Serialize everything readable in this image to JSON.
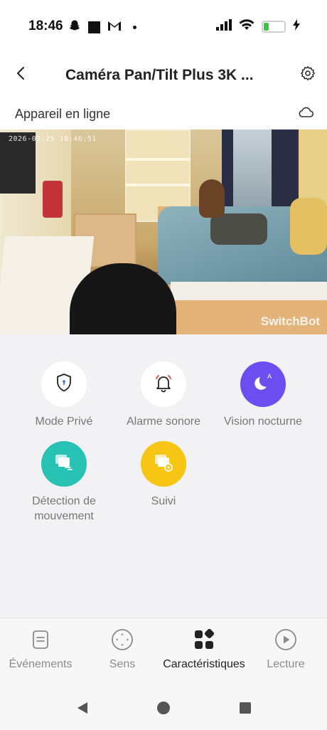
{
  "status_bar": {
    "time": "18:46",
    "left_icons": [
      "snapchat-icon",
      "square-notification-icon",
      "gmail-icon",
      "dot-icon"
    ],
    "right_icons": [
      "signal-icon",
      "wifi-icon",
      "battery-charging-icon"
    ],
    "battery_level": 0.25,
    "battery_color": "#3fc24a"
  },
  "header": {
    "title": "Caméra Pan/Tilt Plus 3K ...",
    "back_icon": "chevron-left-icon",
    "settings_icon": "gear-icon"
  },
  "device": {
    "status": "Appareil en ligne",
    "cloud_icon": "cloud-icon"
  },
  "video": {
    "timestamp": "2026-02-25 18:46:51",
    "watermark": "SwitchBot"
  },
  "features": [
    {
      "label": "Mode Privé",
      "icon": "shield-lock-icon",
      "color": "#ffffff"
    },
    {
      "label": "Alarme sonore",
      "icon": "bell-icon",
      "color": "#ffffff"
    },
    {
      "label": "Vision nocturne",
      "icon": "moon-auto-icon",
      "color": "#6a4ef0"
    },
    {
      "label": "Détection de mouvement",
      "icon": "motion-detection-icon",
      "color": "#27c2b4"
    },
    {
      "label": "Suivi",
      "icon": "tracking-icon",
      "color": "#f7c514"
    }
  ],
  "bottom_nav": [
    {
      "label": "Événements",
      "icon": "events-icon",
      "active": false
    },
    {
      "label": "Sens",
      "icon": "direction-pad-icon",
      "active": false
    },
    {
      "label": "Caractéristiques",
      "icon": "features-grid-icon",
      "active": true
    },
    {
      "label": "Lecture",
      "icon": "play-icon",
      "active": false
    }
  ],
  "system_nav": [
    "back-triangle-icon",
    "home-circle-icon",
    "recents-square-icon"
  ]
}
